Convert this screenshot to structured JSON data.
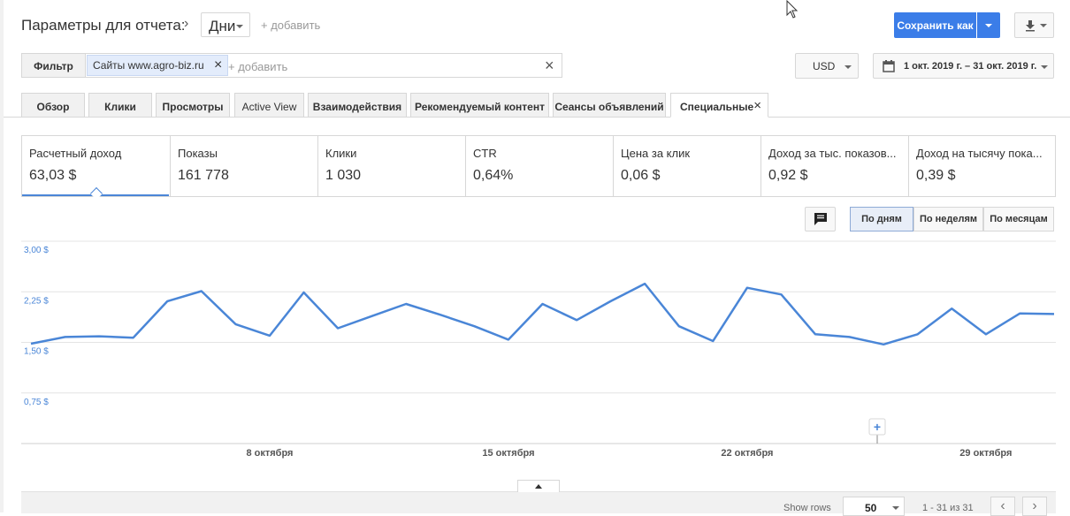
{
  "header": {
    "params_label": "Параметры для отчета:",
    "dimension_value": "Дни",
    "add_label": "+ добавить",
    "save_label": "Сохранить как"
  },
  "filter": {
    "button_label": "Фильтр",
    "chip_label": "Сайты www.agro-biz.ru",
    "add_label": "+ добавить"
  },
  "currency": "USD",
  "date_range": "1 окт. 2019 г. – 31 окт. 2019 г.",
  "tabs": [
    {
      "label": "Обзор"
    },
    {
      "label": "Клики"
    },
    {
      "label": "Просмотры"
    },
    {
      "label": "Active View"
    },
    {
      "label": "Взаимодействия"
    },
    {
      "label": "Рекомендуемый контент"
    },
    {
      "label": "Сеансы объявлений"
    },
    {
      "label": "Специальные"
    }
  ],
  "metrics": [
    {
      "label": "Расчетный доход",
      "value": "63,03 $"
    },
    {
      "label": "Показы",
      "value": "161 778"
    },
    {
      "label": "Клики",
      "value": "1 030"
    },
    {
      "label": "CTR",
      "value": "0,64%"
    },
    {
      "label": "Цена за клик",
      "value": "0,06 $"
    },
    {
      "label": "Доход за тыс. показов...",
      "value": "0,92 $"
    },
    {
      "label": "Доход на тысячу пока...",
      "value": "0,39 $"
    }
  ],
  "granularity": {
    "by_day": "По дням",
    "by_week": "По неделям",
    "by_month": "По месяцам"
  },
  "chart_data": {
    "type": "line",
    "y_ticks": [
      "3,00 $",
      "2,25 $",
      "1,50 $",
      "0,75 $"
    ],
    "ylim": [
      0,
      3.0
    ],
    "x_tick_labels": [
      "8 октября",
      "15 октября",
      "22 октября",
      "29 октября"
    ],
    "x_tick_days": [
      8,
      15,
      22,
      29
    ],
    "x": [
      1,
      2,
      3,
      4,
      5,
      6,
      7,
      8,
      9,
      10,
      11,
      12,
      13,
      14,
      15,
      16,
      17,
      18,
      19,
      20,
      21,
      22,
      23,
      24,
      25,
      26,
      27,
      28,
      29,
      30,
      31
    ],
    "values": [
      1.48,
      1.58,
      1.59,
      1.57,
      2.11,
      2.26,
      1.77,
      1.6,
      2.24,
      1.71,
      1.89,
      2.07,
      1.91,
      1.74,
      1.54,
      2.07,
      1.83,
      2.11,
      2.37,
      1.74,
      1.52,
      2.31,
      2.21,
      1.62,
      1.58,
      1.47,
      1.62,
      2.0,
      1.62,
      1.93,
      1.92
    ],
    "color": "#4a86d7"
  },
  "footer": {
    "show_rows_label": "Show rows",
    "rows_value": "50",
    "range_label": "1 - 31 из 31"
  }
}
